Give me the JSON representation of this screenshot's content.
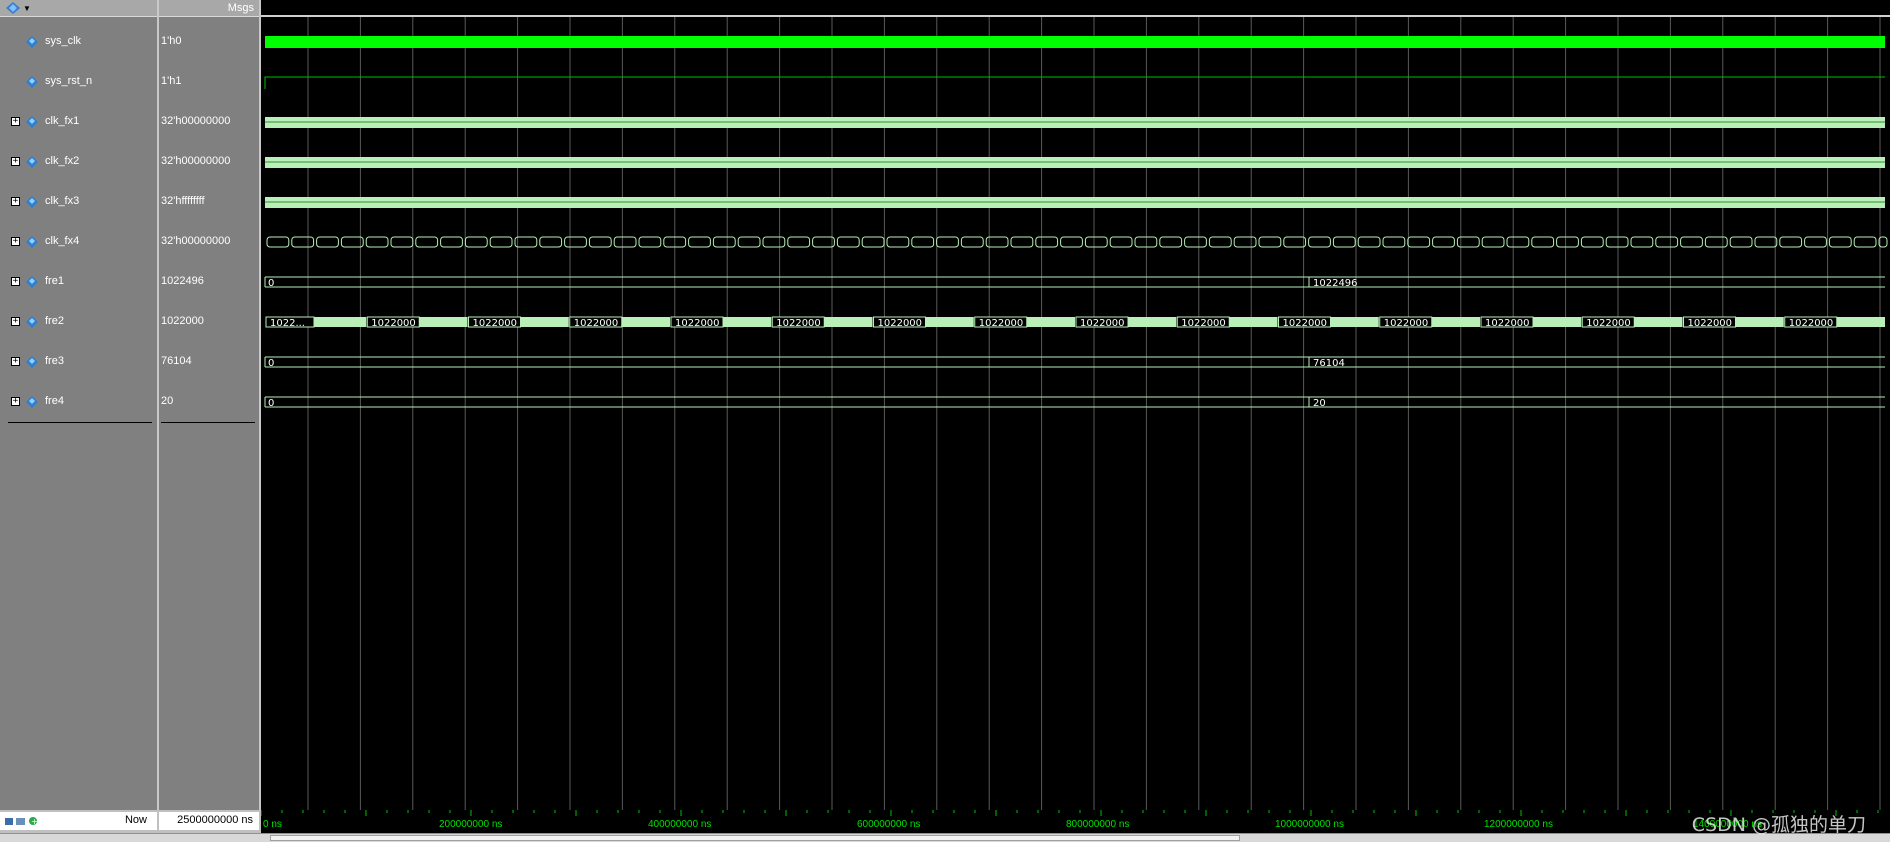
{
  "header": {
    "msgs_label": "Msgs"
  },
  "signals": [
    {
      "name": "sys_clk",
      "value": "1'h0",
      "expandable": false,
      "kind": "clock"
    },
    {
      "name": "sys_rst_n",
      "value": "1'h1",
      "expandable": false,
      "kind": "high"
    },
    {
      "name": "clk_fx1",
      "value": "32'h00000000",
      "expandable": true,
      "kind": "bus_dense"
    },
    {
      "name": "clk_fx2",
      "value": "32'h00000000",
      "expandable": true,
      "kind": "bus_dense"
    },
    {
      "name": "clk_fx3",
      "value": "32'hffffffff",
      "expandable": true,
      "kind": "bus_dense"
    },
    {
      "name": "clk_fx4",
      "value": "32'h00000000",
      "expandable": true,
      "kind": "bus_toggle"
    },
    {
      "name": "fre1",
      "value": "1022496",
      "expandable": true,
      "kind": "bus_step",
      "wave_values": [
        "0",
        "1022496"
      ]
    },
    {
      "name": "fre2",
      "value": "1022000",
      "expandable": true,
      "kind": "bus_periodic",
      "wave_values": [
        "1022...",
        "1022000",
        "1022000",
        "1022000",
        "1022000",
        "1022000",
        "1022000",
        "1022000",
        "1022000",
        "1022000",
        "1022000",
        "1022000",
        "1022000",
        "1022000",
        "1022000",
        "1022000"
      ]
    },
    {
      "name": "fre3",
      "value": "76104",
      "expandable": true,
      "kind": "bus_step",
      "wave_values": [
        "0",
        "76104"
      ]
    },
    {
      "name": "fre4",
      "value": "20",
      "expandable": true,
      "kind": "bus_step",
      "wave_values": [
        "0",
        "20"
      ]
    }
  ],
  "cursor": {
    "now_label": "Now",
    "now_value": "2500000000 ns"
  },
  "timeline": {
    "start_label": "0 ns",
    "labels": [
      "200000000 ns",
      "400000000 ns",
      "600000000 ns",
      "800000000 ns",
      "1000000000 ns",
      "1200000000 ns",
      "1400000000 ns"
    ]
  },
  "watermark": "CSDN @孤独的单刀",
  "colors": {
    "clock": "#00ff00",
    "bus": "#b8f0b8",
    "line": "#00c000",
    "grid": "#5a5a5a"
  }
}
